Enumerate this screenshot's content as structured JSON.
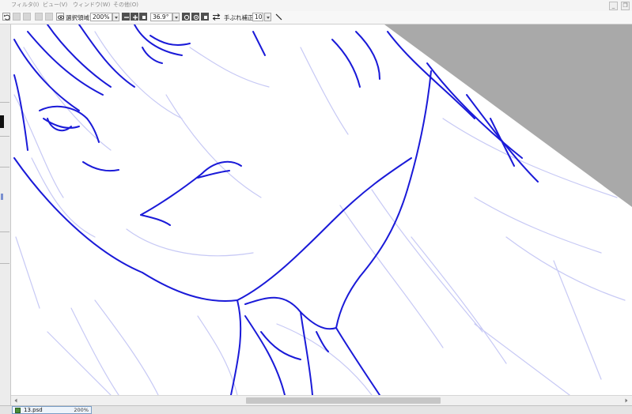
{
  "menubar": {
    "items": [
      {
        "label": "フィルタ(I)"
      },
      {
        "label": "ビュー(V)"
      },
      {
        "label": "ウィンドウ(W)"
      },
      {
        "label": "その他(O)"
      }
    ],
    "window_controls": {
      "minimize": "_",
      "restore": "❐"
    }
  },
  "toolbar": {
    "selection_label": "選択領域",
    "zoom_value": "200%",
    "rotation_value": "36.9°",
    "stabilizer_label": "手ぶれ補正",
    "stabilizer_value": "10"
  },
  "status": {
    "document_name": "13.psd",
    "document_zoom": "200%"
  },
  "colors": {
    "line_art": "#1a1ad8",
    "sketch": "#c7c9f5",
    "outside_canvas": "#a9a9a9",
    "tab_border": "#7a9ec7"
  },
  "icons": {
    "undo": "undo-icon",
    "view": "eye-icon",
    "zoom_in": "zoom-in-icon",
    "zoom_out": "zoom-out-icon",
    "rotate_left": "rotate-left-icon",
    "rotate_right": "rotate-right-icon",
    "flip": "flip-horizontal-icon",
    "pen": "pen-icon"
  }
}
